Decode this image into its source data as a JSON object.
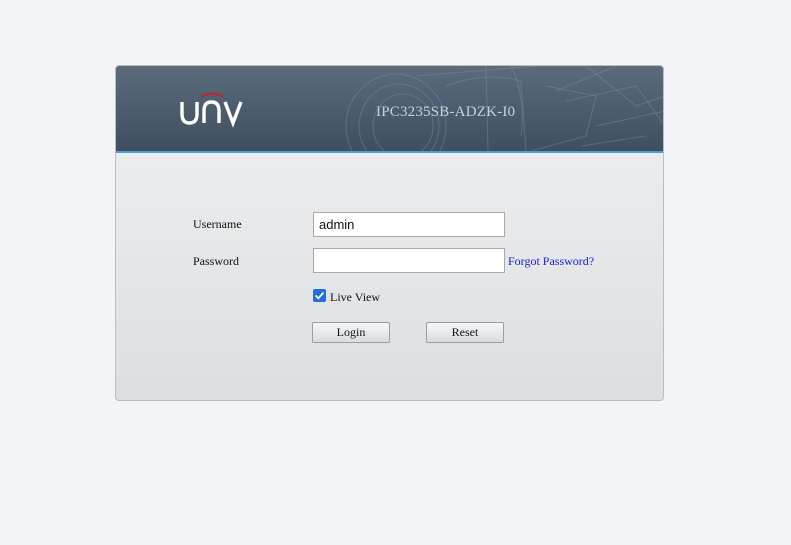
{
  "header": {
    "brand": "UNV",
    "model": "IPC3235SB-ADZK-I0",
    "accent_color": "#4a9ed6",
    "logo_arc_color": "#c8202b"
  },
  "form": {
    "username_label": "Username",
    "username_value": "admin",
    "password_label": "Password",
    "password_value": "",
    "forgot_password": "Forgot Password?",
    "live_view_label": "Live View",
    "live_view_checked": true,
    "login_label": "Login",
    "reset_label": "Reset"
  }
}
